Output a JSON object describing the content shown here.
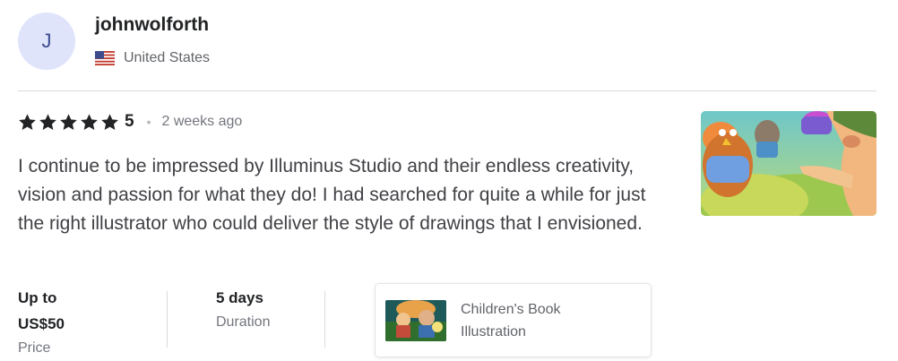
{
  "reviewer": {
    "avatar_initial": "J",
    "username": "johnwolforth",
    "country": "United States",
    "flag_icon": "us-flag-icon"
  },
  "rating": {
    "stars": 5,
    "score": "5",
    "time_ago": "2 weeks ago"
  },
  "review": {
    "text": "I continue to be impressed by Illuminus Studio and their endless creativity, vision and passion for what they do! I had searched for quite a while for just the right illustrator who could deliver the style of drawings that I envisioned."
  },
  "details": {
    "price": {
      "value_line1": "Up to",
      "value_line2": "US$50",
      "label": "Price"
    },
    "duration": {
      "value": "5 days",
      "label": "Duration"
    }
  },
  "gig": {
    "title": "Children's Book Illustration"
  },
  "colors": {
    "star": "#222325",
    "avatar_bg": "#dfe4fb",
    "divider": "#dadbdd"
  }
}
